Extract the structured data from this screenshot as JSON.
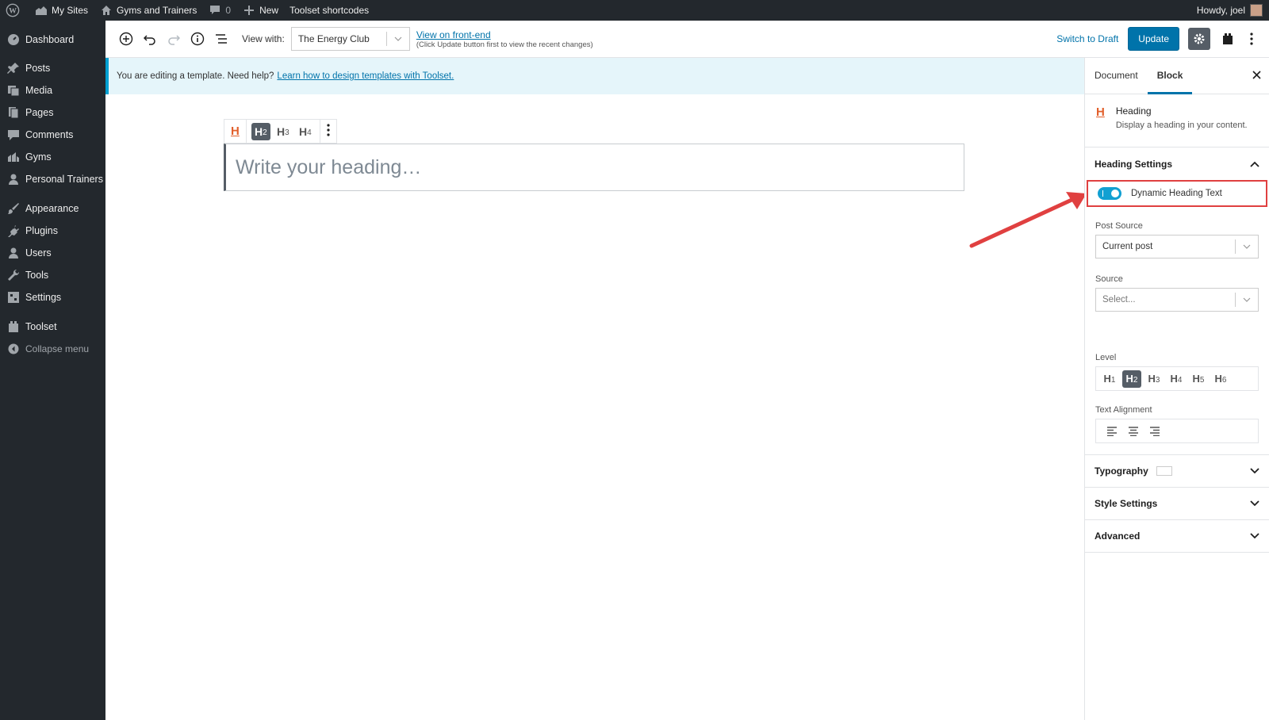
{
  "adminbar": {
    "my_sites": "My Sites",
    "site_name": "Gyms and Trainers",
    "comments_count": "0",
    "new": "New",
    "toolset_shortcodes": "Toolset shortcodes",
    "howdy": "Howdy, joel"
  },
  "menu": {
    "items": [
      {
        "label": "Dashboard",
        "icon": "dashboard-icon"
      },
      {
        "label": "Posts",
        "icon": "pin-icon"
      },
      {
        "label": "Media",
        "icon": "media-icon"
      },
      {
        "label": "Pages",
        "icon": "pages-icon"
      },
      {
        "label": "Comments",
        "icon": "comment-icon"
      },
      {
        "label": "Gyms",
        "icon": "gym-icon"
      },
      {
        "label": "Personal Trainers",
        "icon": "user-icon"
      },
      {
        "label": "Appearance",
        "icon": "brush-icon"
      },
      {
        "label": "Plugins",
        "icon": "plugin-icon"
      },
      {
        "label": "Users",
        "icon": "users-icon"
      },
      {
        "label": "Tools",
        "icon": "wrench-icon"
      },
      {
        "label": "Settings",
        "icon": "settings-icon"
      },
      {
        "label": "Toolset",
        "icon": "toolset-icon"
      }
    ],
    "collapse": "Collapse menu"
  },
  "header": {
    "view_with_label": "View with:",
    "view_with_value": "The Energy Club",
    "view_front_end": "View on front-end",
    "front_end_hint": "(Click Update button first to view the recent changes)",
    "switch_to_draft": "Switch to Draft",
    "update": "Update"
  },
  "notice": {
    "text": "You are editing a template. Need help?",
    "link": "Learn how to design templates with Toolset."
  },
  "editor": {
    "heading_placeholder": "Write your heading…",
    "toolbar_levels": [
      {
        "label": "H",
        "sub": "2",
        "active": true
      },
      {
        "label": "H",
        "sub": "3",
        "active": false
      },
      {
        "label": "H",
        "sub": "4",
        "active": false
      }
    ]
  },
  "sidebar": {
    "tab_document": "Document",
    "tab_block": "Block",
    "block_title": "Heading",
    "block_desc": "Display a heading in your content.",
    "heading_settings": "Heading Settings",
    "dynamic_toggle": "Dynamic Heading Text",
    "dynamic_toggle_on": true,
    "post_source_label": "Post Source",
    "post_source_value": "Current post",
    "source_label": "Source",
    "source_placeholder": "Select...",
    "level_label": "Level",
    "levels": [
      {
        "label": "H",
        "sub": "1",
        "active": false
      },
      {
        "label": "H",
        "sub": "2",
        "active": true
      },
      {
        "label": "H",
        "sub": "3",
        "active": false
      },
      {
        "label": "H",
        "sub": "4",
        "active": false
      },
      {
        "label": "H",
        "sub": "5",
        "active": false
      },
      {
        "label": "H",
        "sub": "6",
        "active": false
      }
    ],
    "text_alignment_label": "Text Alignment",
    "typography": "Typography",
    "style_settings": "Style Settings",
    "advanced": "Advanced"
  },
  "colors": {
    "admin_dark": "#23282d",
    "primary": "#0073aa",
    "toggle_on": "#11a0d2",
    "highlight": "#e04040",
    "heading_icon": "#e2602c"
  }
}
